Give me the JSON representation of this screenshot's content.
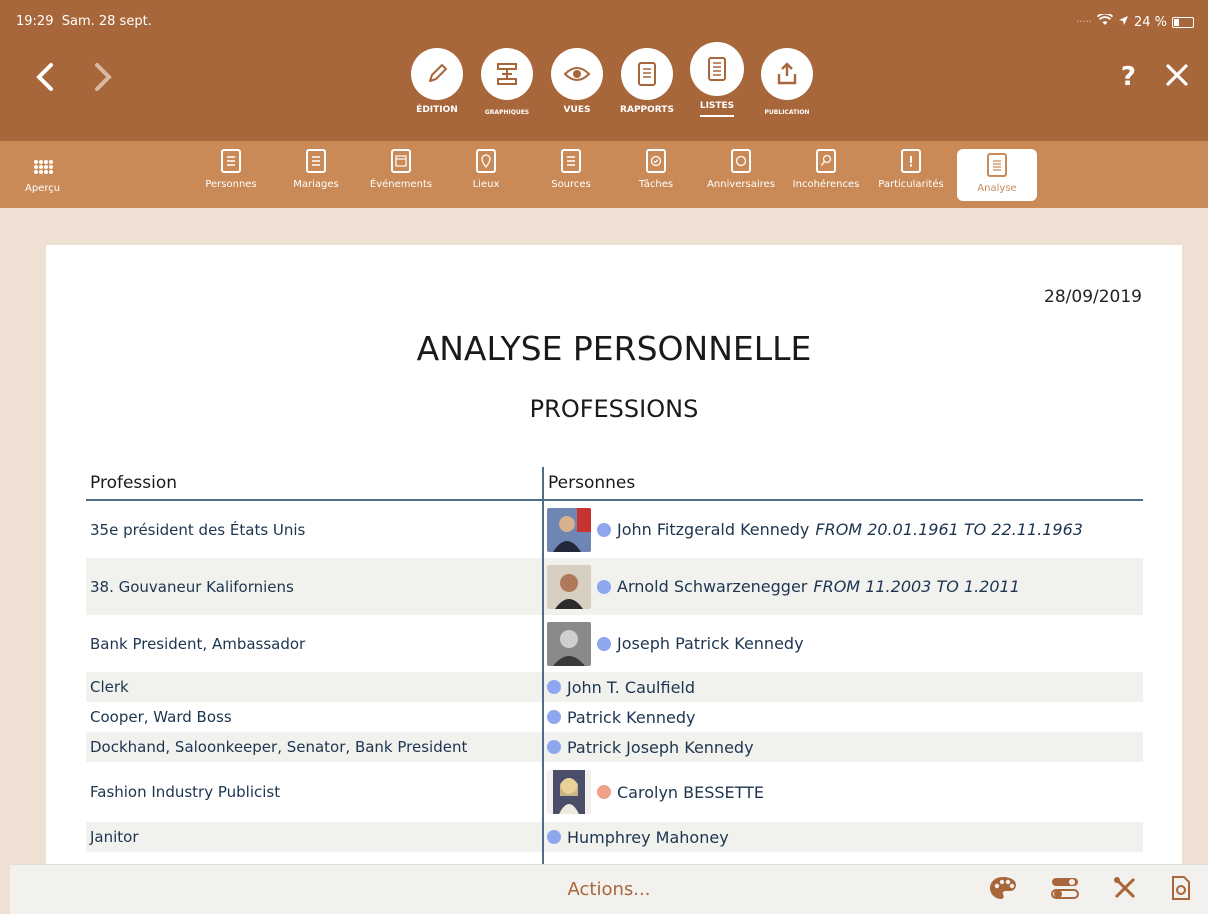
{
  "status": {
    "time": "19:29",
    "date": "Sam. 28 sept.",
    "battery": "24 %"
  },
  "modes": [
    {
      "label": "ÉDITION",
      "icon": "pencil-icon"
    },
    {
      "label": "GRAPHIQUES",
      "icon": "chart-tree-icon"
    },
    {
      "label": "VUES",
      "icon": "eye-icon"
    },
    {
      "label": "RAPPORTS",
      "icon": "report-icon"
    },
    {
      "label": "LISTES",
      "icon": "list-icon",
      "active": true
    },
    {
      "label": "PUBLICATION",
      "icon": "upload-icon"
    }
  ],
  "help_label": "?",
  "subtabs": {
    "apercu": "Aperçu",
    "items": [
      {
        "label": "Personnes",
        "icon": "persons-icon"
      },
      {
        "label": "Mariages",
        "icon": "marriages-icon"
      },
      {
        "label": "Événements",
        "icon": "events-icon"
      },
      {
        "label": "Lieux",
        "icon": "place-icon"
      },
      {
        "label": "Sources",
        "icon": "sources-icon"
      },
      {
        "label": "Tâches",
        "icon": "tasks-icon"
      },
      {
        "label": "Anniversaires",
        "icon": "anniversary-icon"
      },
      {
        "label": "Incohérences",
        "icon": "search-icon"
      },
      {
        "label": "Particularités",
        "icon": "exclamation-icon"
      },
      {
        "label": "Analyse",
        "icon": "analysis-icon",
        "active": true
      }
    ]
  },
  "report": {
    "date": "28/09/2019",
    "title": "ANALYSE PERSONNELLE",
    "subtitle": "PROFESSIONS",
    "headers": {
      "profession": "Profession",
      "persons": "Personnes"
    },
    "rows": [
      {
        "profession": "35e président des États Unis",
        "person": "John Fitzgerald Kennedy",
        "period": "FROM 20.01.1961 TO 22.11.1963",
        "gender": "male",
        "photo": true
      },
      {
        "profession": "38. Gouvaneur Kaliforniens",
        "person": "Arnold Schwarzenegger",
        "period": "FROM 11.2003 TO 1.2011",
        "gender": "male",
        "photo": true
      },
      {
        "profession": "Bank President, Ambassador",
        "person": "Joseph Patrick Kennedy",
        "period": "",
        "gender": "male",
        "photo": true
      },
      {
        "profession": "Clerk",
        "person": "John T. Caulfield",
        "period": "",
        "gender": "male",
        "photo": false
      },
      {
        "profession": "Cooper, Ward Boss",
        "person": "Patrick Kennedy",
        "period": "",
        "gender": "male",
        "photo": false
      },
      {
        "profession": "Dockhand, Saloonkeeper, Senator, Bank President",
        "person": "Patrick Joseph Kennedy",
        "period": "",
        "gender": "male",
        "photo": false
      },
      {
        "profession": "Fashion Industry Publicist",
        "person": "Carolyn BESSETTE",
        "period": "",
        "gender": "female",
        "photo": true
      },
      {
        "profession": "Janitor",
        "person": "Humphrey Mahoney",
        "period": "",
        "gender": "male",
        "photo": false
      }
    ]
  },
  "bottom": {
    "actions": "Actions..."
  },
  "colors": {
    "topbar": "#a8673b",
    "subbar": "#c98a57",
    "link": "#1d3550",
    "male": "#8ea7ee",
    "female": "#f0a08a"
  }
}
